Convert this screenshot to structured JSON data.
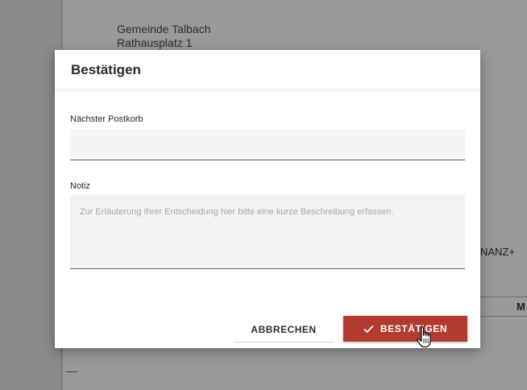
{
  "background": {
    "address_line1": "Gemeinde Talbach",
    "address_line2": "Rathausplatz 1",
    "partial_text": "NANZ+",
    "partial_column": "M"
  },
  "dialog": {
    "title": "Bestätigen",
    "fields": {
      "postkorb": {
        "label": "Nächster Postkorb",
        "value": ""
      },
      "notiz": {
        "label": "Notiz",
        "placeholder": "Zur Erläuterung Ihrer Entscheidung hier bitte eine kurze Beschreibung erfassen."
      }
    },
    "buttons": {
      "cancel_label": "ABBRECHEN",
      "confirm_label": "BESTÄTIGEN"
    }
  },
  "icons": {
    "confirm": "check-icon",
    "pointer": "hand-pointer-icon"
  },
  "colors": {
    "primary": "#b23a2e",
    "overlay": "#8f8f8f"
  }
}
